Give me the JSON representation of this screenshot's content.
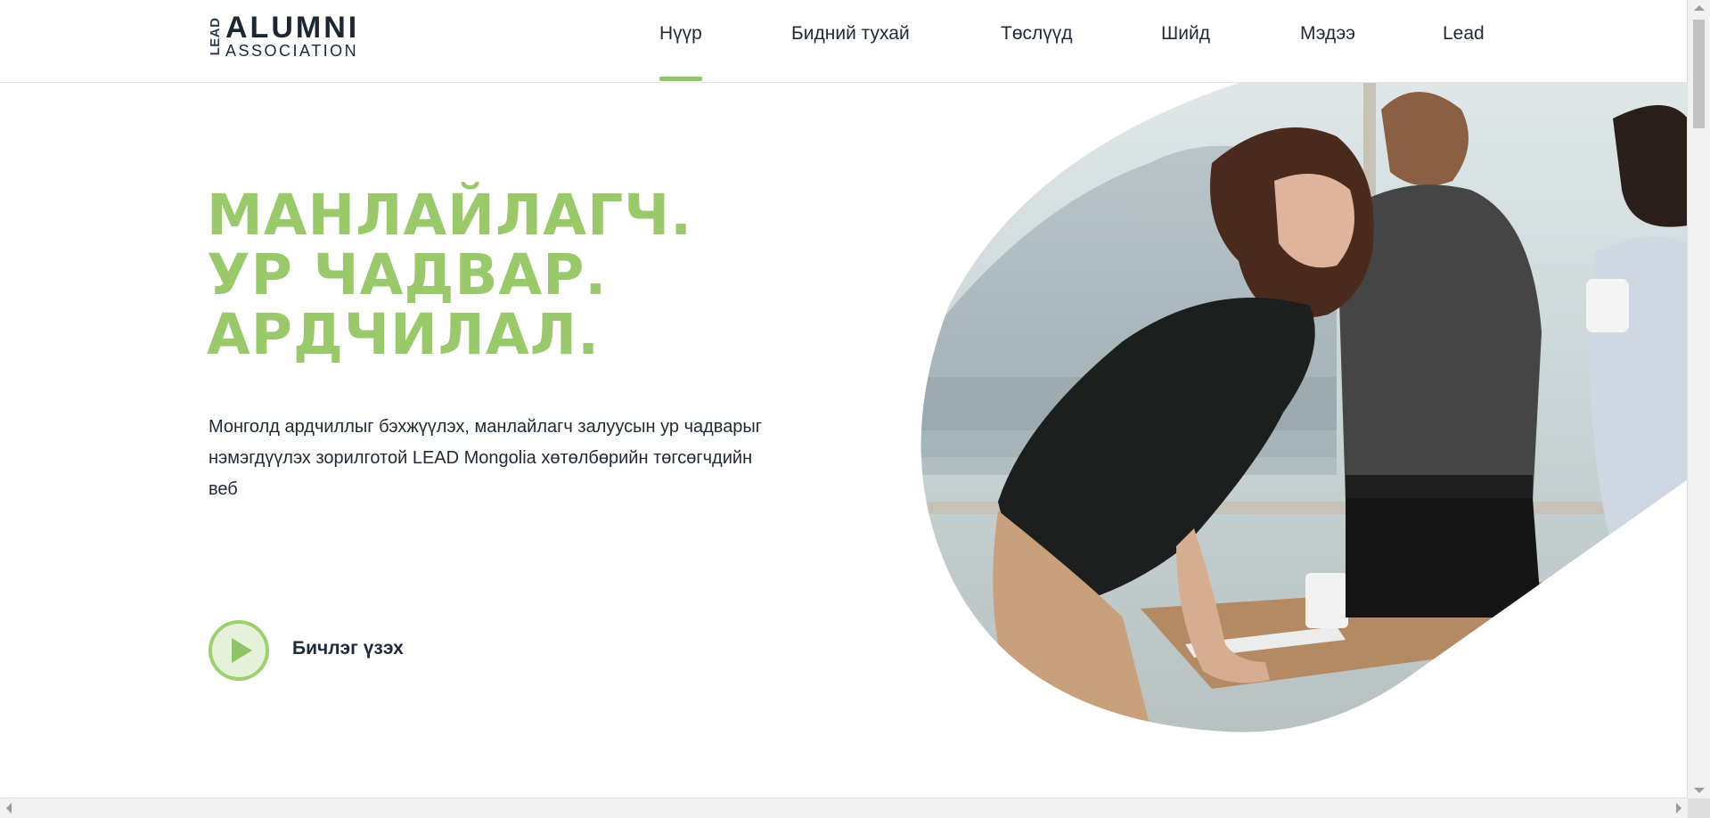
{
  "logo": {
    "vertical_text": "LEAD",
    "top_text": "ALUMNI",
    "bottom_text": "ASSOCIATION"
  },
  "nav": {
    "items": [
      {
        "label": "Нүүр",
        "active": true
      },
      {
        "label": "Бидний тухай",
        "active": false
      },
      {
        "label": "Төслүүд",
        "active": false
      },
      {
        "label": "Шийд",
        "active": false
      },
      {
        "label": "Мэдээ",
        "active": false
      },
      {
        "label": "Lead",
        "active": false
      }
    ]
  },
  "hero": {
    "headline": [
      "МАНЛАЙЛАГЧ.",
      "УР ЧАДВАР.",
      "АРДЧИЛАЛ."
    ],
    "description": "Монголд ардчиллыг бэхжүүлэх, манлайлагч залуусын ур чадварыг нэмэгдүүлэх зорилготой LEAD Mongolia хөтөлбөрийн төгсөгчдийн веб",
    "video_label": "Бичлэг үзэх"
  },
  "colors": {
    "accent": "#99c96a",
    "text": "#1f2a36",
    "play_ring": "#9fd070"
  },
  "icons": {
    "play": "play-icon"
  }
}
